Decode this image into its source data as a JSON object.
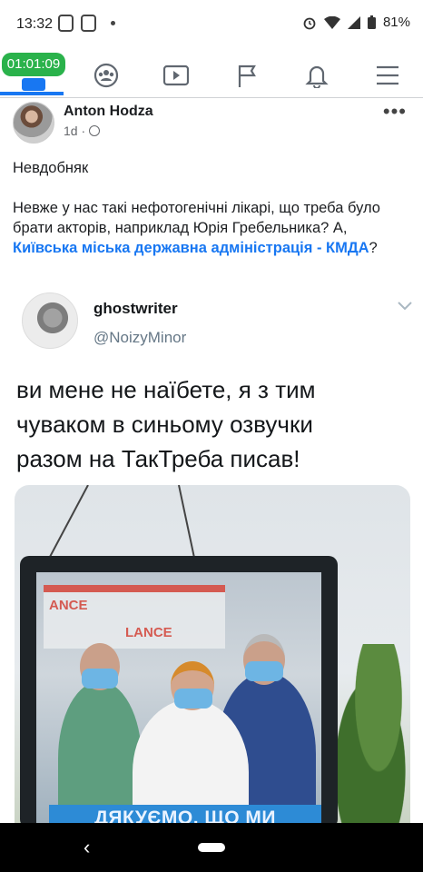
{
  "status_bar": {
    "time": "13:32",
    "battery": "81%"
  },
  "fb_nav": {
    "timer": "01:01:09",
    "tabs": [
      "home-icon",
      "groups-icon",
      "watch-icon",
      "pages-icon",
      "notifications-icon",
      "menu-icon"
    ],
    "accent": "#1877f2"
  },
  "post": {
    "author": "Anton Hodza",
    "meta": "1d ·",
    "line1": "Невдобняк",
    "line2_text": "Невже у нас такі нефотогенічні лікарі, що треба було брати акторів, наприклад Юрія Гребельника? А, ",
    "line2_link": "Київська міська державна адміністрація - КМДА",
    "line2_end": "?"
  },
  "tweet": {
    "name": "ghostwriter",
    "handle": "@NoizyMinor",
    "text": "ви мене не наїбете, я з тим\nчуваком в синьому озвучки\nразом на ТакТреба писав!",
    "photo_caption": "ДЯКУЄМО, ЩО МИ",
    "ambulance_text_1": "ANCE",
    "ambulance_text_2": "LANCE"
  },
  "android_nav": {
    "back": "‹"
  }
}
